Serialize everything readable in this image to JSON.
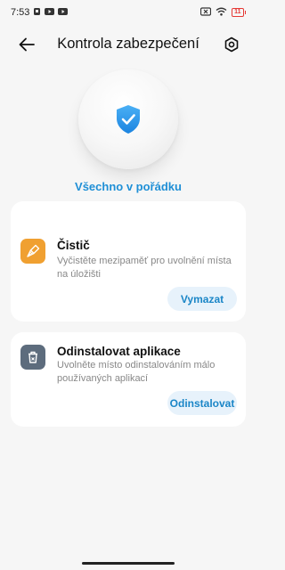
{
  "status_bar": {
    "time": "7:53",
    "icons": [
      "nfc-icon",
      "youtube-icon",
      "youtube-icon"
    ],
    "right_icons": [
      "battery-saver-icon",
      "wifi-icon",
      "battery-icon"
    ],
    "battery": "11"
  },
  "header": {
    "title": "Kontrola zabezpečení",
    "back_icon": "arrow-left-icon",
    "settings_icon": "gear-icon"
  },
  "hero": {
    "icon": "shield-check-icon",
    "status": "Všechno v pořádku",
    "status_color": "#1f8fd6"
  },
  "cards": [
    {
      "title": "Čistič",
      "description": "Vyčistěte mezipaměť pro uvolnění místa na úložišti",
      "button": "Vymazat",
      "icon": "broom-icon",
      "icon_color": "#f0a031"
    },
    {
      "title": "Odinstalovat aplikace",
      "description": "Uvolněte místo odinstalováním málo používaných aplikací",
      "button": "Odinstalovat",
      "icon": "trash-icon",
      "icon_color": "#5d6c7d"
    }
  ]
}
